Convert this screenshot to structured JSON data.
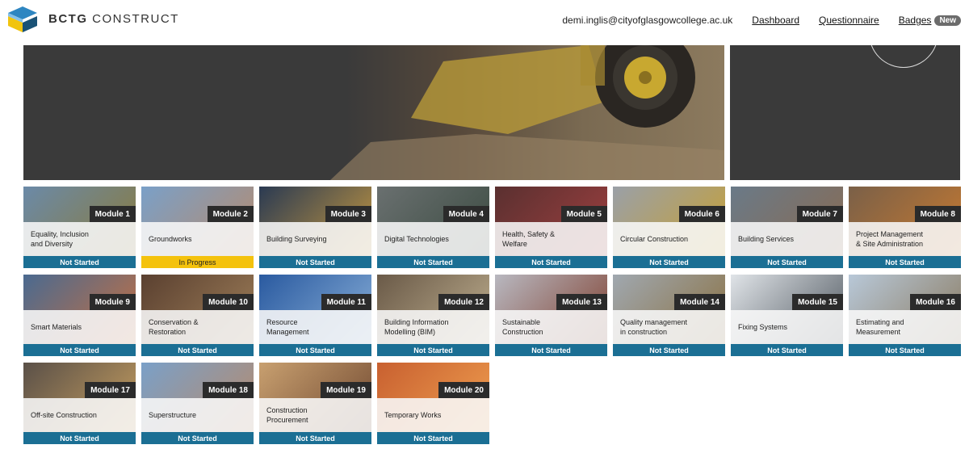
{
  "brand": {
    "bold": "BCTG",
    "rest": " CONSTRUCT"
  },
  "nav": {
    "email": "demi.inglis@cityofglasgowcollege.ac.uk",
    "dashboard": "Dashboard",
    "questionnaire": "Questionnaire",
    "badges": "Badges",
    "new_pill": "New"
  },
  "colors": {
    "status_blue": "#1b6f94",
    "status_yellow": "#f4c20d",
    "tag_dark": "#2b2b2b"
  },
  "modules": [
    {
      "tag": "Module 1",
      "title": "Equality, Inclusion\nand Diversity",
      "status": "Not Started",
      "state": "not",
      "img": [
        "#6b8aa8",
        "#8a7a3a"
      ]
    },
    {
      "tag": "Module 2",
      "title": "Groundworks",
      "status": "In Progress",
      "state": "progress",
      "img": [
        "#7aa0c8",
        "#b88a6a"
      ]
    },
    {
      "tag": "Module 3",
      "title": "Building Surveying",
      "status": "Not Started",
      "state": "not",
      "img": [
        "#2a3a52",
        "#c89a40"
      ]
    },
    {
      "tag": "Module 4",
      "title": "Digital Technologies",
      "status": "Not Started",
      "state": "not",
      "img": [
        "#6a7070",
        "#3a4a40"
      ]
    },
    {
      "tag": "Module 5",
      "title": "Health, Safety &\nWelfare",
      "status": "Not Started",
      "state": "not",
      "img": [
        "#5a3030",
        "#a04040"
      ]
    },
    {
      "tag": "Module 6",
      "title": "Circular Construction",
      "status": "Not Started",
      "state": "not",
      "img": [
        "#9aa0a8",
        "#c8a030"
      ]
    },
    {
      "tag": "Module 7",
      "title": "Building Services",
      "status": "Not Started",
      "state": "not",
      "img": [
        "#6a7a88",
        "#8a6a50"
      ]
    },
    {
      "tag": "Module 8",
      "title": "Project Management\n& Site Administration",
      "status": "Not Started",
      "state": "not",
      "img": [
        "#7a6048",
        "#c87a30"
      ]
    },
    {
      "tag": "Module 9",
      "title": "Smart Materials",
      "status": "Not Started",
      "state": "not",
      "img": [
        "#4a6a90",
        "#c87040"
      ]
    },
    {
      "tag": "Module 10",
      "title": "Conservation &\nRestoration",
      "status": "Not Started",
      "state": "not",
      "img": [
        "#5a4030",
        "#a0805a"
      ]
    },
    {
      "tag": "Module 11",
      "title": "Resource\nManagement",
      "status": "Not Started",
      "state": "not",
      "img": [
        "#2a5aa0",
        "#8ab0d8"
      ]
    },
    {
      "tag": "Module 12",
      "title": "Building Information\nModelling (BIM)",
      "status": "Not Started",
      "state": "not",
      "img": [
        "#6a5a48",
        "#c0b090"
      ]
    },
    {
      "tag": "Module 13",
      "title": "Sustainable\nConstruction",
      "status": "Not Started",
      "state": "not",
      "img": [
        "#b8b8c0",
        "#804030"
      ]
    },
    {
      "tag": "Module 14",
      "title": "Quality management\nin construction",
      "status": "Not Started",
      "state": "not",
      "img": [
        "#a0a8b0",
        "#8a7040"
      ]
    },
    {
      "tag": "Module 15",
      "title": "Fixing Systems",
      "status": "Not Started",
      "state": "not",
      "img": [
        "#e0e4e8",
        "#505860"
      ]
    },
    {
      "tag": "Module 16",
      "title": "Estimating and\nMeasurement",
      "status": "Not Started",
      "state": "not",
      "img": [
        "#b8c8d8",
        "#8a7a60"
      ]
    },
    {
      "tag": "Module 17",
      "title": "Off-site Construction",
      "status": "Not Started",
      "state": "not",
      "img": [
        "#5a5048",
        "#c8a060"
      ]
    },
    {
      "tag": "Module 18",
      "title": "Superstructure",
      "status": "Not Started",
      "state": "not",
      "img": [
        "#7aa0c8",
        "#b88a6a"
      ]
    },
    {
      "tag": "Module 19",
      "title": "Construction\nProcurement",
      "status": "Not Started",
      "state": "not",
      "img": [
        "#c8a070",
        "#704830"
      ]
    },
    {
      "tag": "Module 20",
      "title": "Temporary Works",
      "status": "Not Started",
      "state": "not",
      "img": [
        "#c86030",
        "#f0a050"
      ]
    }
  ]
}
